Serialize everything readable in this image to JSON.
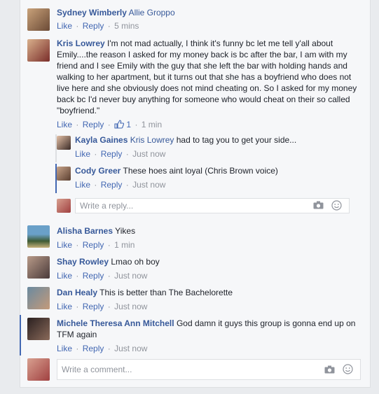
{
  "actions": {
    "like": "Like",
    "reply": "Reply",
    "sep": "·"
  },
  "comments": [
    {
      "name": "Sydney Wimberly",
      "text_tag": "Allie Groppo",
      "text": "",
      "time": "5 mins"
    },
    {
      "name": "Kris Lowrey",
      "text": "I'm not mad actually, I think it's funny bc let me tell y'all about Emily....the reason I asked for my money back is bc after the bar, I am with my friend and I see Emily with the guy that she left the bar with holding hands and walking to her apartment, but it turns out that she has a boyfriend who does not live here and she obviously does not mind cheating on. So I asked for my money back bc I'd never buy anything for someone who would cheat on their so called \"boyfriend.\"",
      "likes": "1",
      "time": "1 min"
    },
    {
      "name": "Alisha Barnes",
      "text": "Yikes",
      "time": "1 min"
    },
    {
      "name": "Shay Rowley",
      "text": "Lmao oh boy",
      "time": "Just now"
    },
    {
      "name": "Dan Healy",
      "text": "This is better than The Bachelorette",
      "time": "Just now"
    },
    {
      "name": "Michele Theresa Ann Mitchell",
      "text": "God damn it guys this group is gonna end up on TFM again",
      "time": "Just now"
    }
  ],
  "replies": [
    {
      "name": "Kayla Gaines",
      "text_tag": "Kris Lowrey",
      "text": " had to tag you to get your side...",
      "time": "Just now"
    },
    {
      "name": "Cody Greer",
      "text": "These hoes aint loyal (Chris Brown voice)",
      "time": "Just now"
    }
  ],
  "reply_box": {
    "placeholder": "Write a reply..."
  },
  "comment_box": {
    "placeholder": "Write a comment..."
  },
  "colors": {
    "link": "#365899",
    "meta": "#90949c",
    "accent": "#4267b2"
  },
  "icons": {
    "camera": "camera-icon",
    "emoji": "emoji-icon",
    "like": "thumbs-up-icon"
  }
}
